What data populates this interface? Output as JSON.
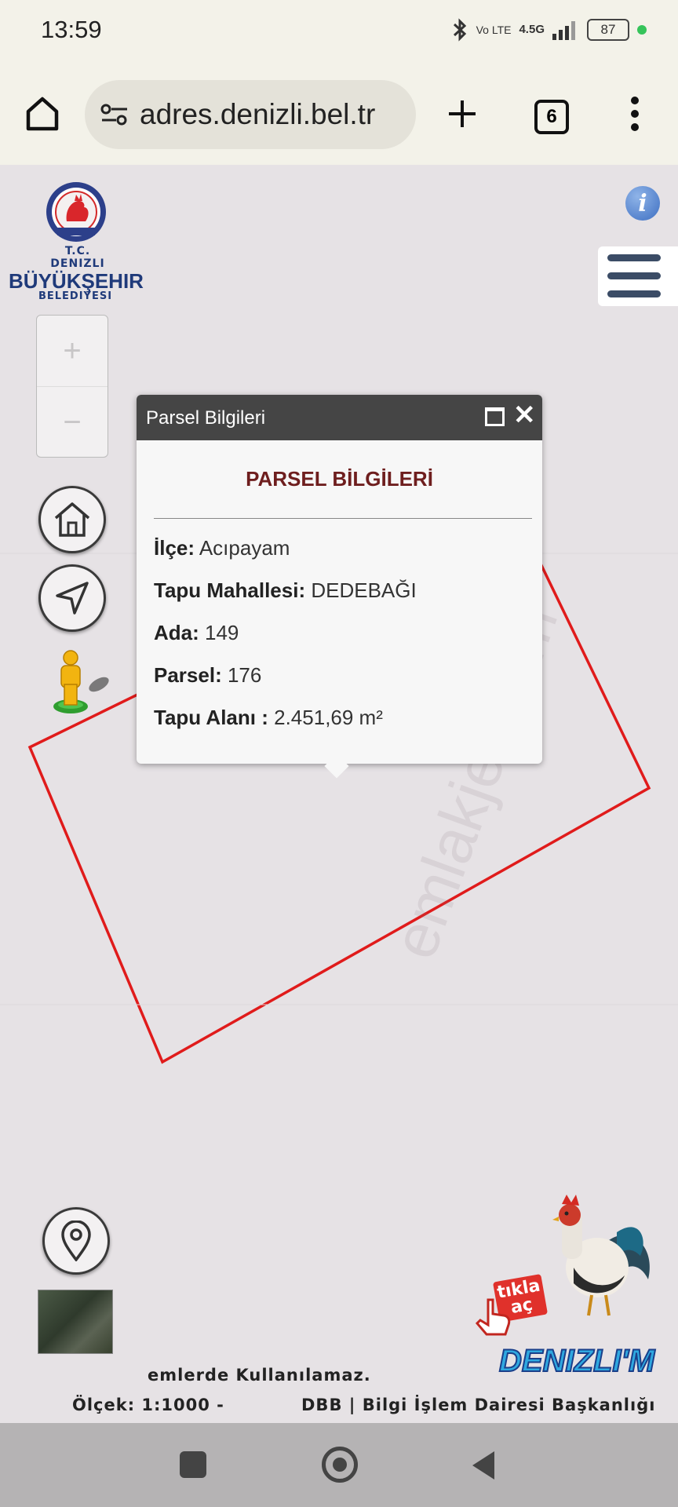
{
  "status_bar": {
    "time": "13:59",
    "network": "4.5G",
    "volte": "Vo LTE",
    "battery": "87",
    "icons": [
      "bluetooth-icon",
      "signal-icon",
      "battery-icon"
    ]
  },
  "browser": {
    "url": "adres.denizli.bel.tr",
    "tab_count": "6",
    "icons": [
      "home-icon",
      "site-settings-icon",
      "new-tab-icon",
      "more-icon"
    ]
  },
  "logo": {
    "line1": "T.C.",
    "line2": "DENIZLI",
    "line3": "BÜYÜKŞEHIR",
    "line4": "BELEDIYESI"
  },
  "map_controls": {
    "zoom_in": "+",
    "zoom_out": "−",
    "info": "i"
  },
  "popup": {
    "title": "Parsel Bilgileri",
    "heading": "PARSEL BİLGİLERİ",
    "rows": [
      {
        "label": "İlçe:",
        "value": "Acıpayam"
      },
      {
        "label": "Tapu Mahallesi:",
        "value": "DEDEBAĞI"
      },
      {
        "label": "Ada:",
        "value": "149"
      },
      {
        "label": "Parsel:",
        "value": "176"
      },
      {
        "label": "Tapu Alanı :",
        "value": "2.451,69 m²"
      }
    ]
  },
  "watermark": "emlakjet.com",
  "footer": {
    "line1": "emlerde Kullanılamaz.",
    "scale": "Ölçek: 1:1000 -",
    "credit": "DBB | Bilgi İşlem Dairesi Başkanlığı"
  },
  "promo": {
    "tikla": "tıkla",
    "ac": "aç",
    "brand": "DENIZLI'M"
  },
  "colors": {
    "parcel_outline": "#e01b1b",
    "popup_header": "#454545",
    "popup_heading": "#6e1e1e",
    "map_background": "#e6e2e5"
  }
}
